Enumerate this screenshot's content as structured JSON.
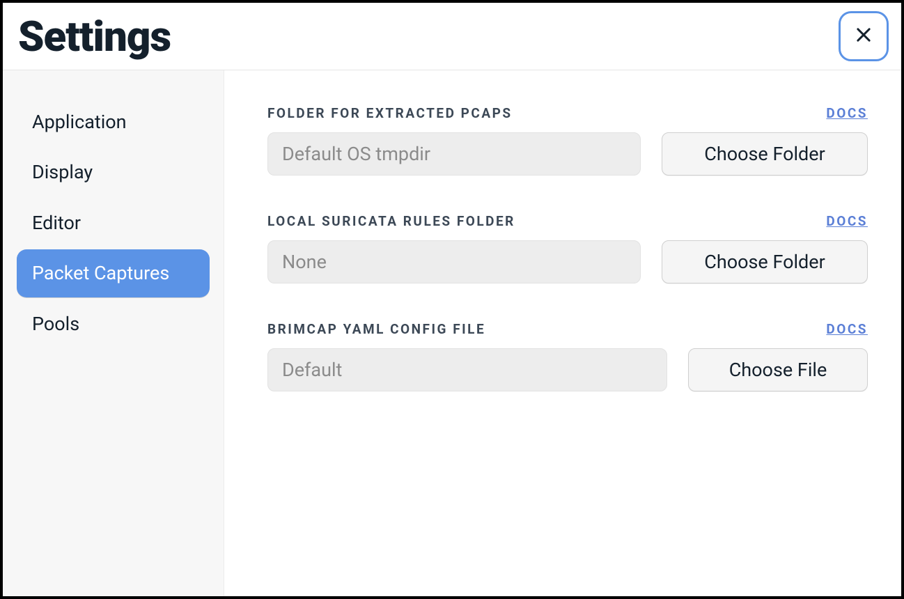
{
  "header": {
    "title": "Settings"
  },
  "sidebar": {
    "items": [
      {
        "label": "Application"
      },
      {
        "label": "Display"
      },
      {
        "label": "Editor"
      },
      {
        "label": "Packet Captures"
      },
      {
        "label": "Pools"
      }
    ],
    "active_index": 3
  },
  "main": {
    "docs_label": "DOCS",
    "settings": [
      {
        "label": "FOLDER FOR EXTRACTED PCAPS",
        "value": "Default OS tmpdir",
        "button": "Choose Folder",
        "button_style": "wide"
      },
      {
        "label": "LOCAL SURICATA RULES FOLDER",
        "value": "None",
        "button": "Choose Folder",
        "button_style": "wide"
      },
      {
        "label": "BRIMCAP YAML CONFIG FILE",
        "value": "Default",
        "button": "Choose File",
        "button_style": "narrow"
      }
    ]
  }
}
